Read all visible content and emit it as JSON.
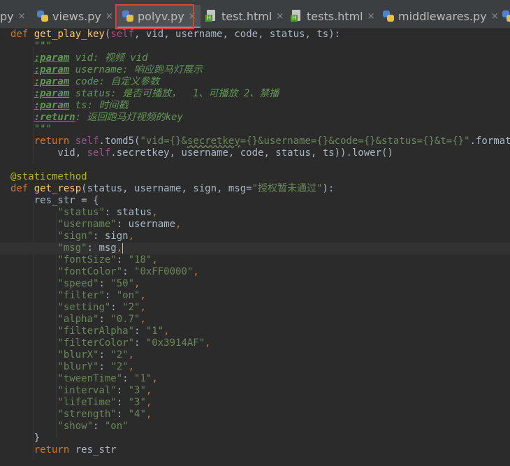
{
  "tabs": [
    {
      "label": "py",
      "type": "python",
      "close": "×"
    },
    {
      "label": "views.py",
      "type": "python",
      "close": "×"
    },
    {
      "label": "polyv.py",
      "type": "python",
      "close": "×",
      "active": true
    },
    {
      "label": "test.html",
      "type": "html",
      "close": "×"
    },
    {
      "label": "tests.html",
      "type": "html",
      "close": "×"
    },
    {
      "label": "middlewares.py",
      "type": "python",
      "close": "×"
    }
  ],
  "code": {
    "def1": "def",
    "fn1": "get_play_key",
    "params1_self": "self",
    "params1_rest": ", vid, username, code, status, ts):",
    "doc_open": "\"\"\"",
    "doc_lines": [
      {
        "tag": ":param",
        "name": " vid: ",
        "text": "视频 vid"
      },
      {
        "tag": ":param",
        "name": " username: ",
        "text": "响应跑马灯展示"
      },
      {
        "tag": ":param",
        "name": " code: ",
        "text": "自定义参数"
      },
      {
        "tag": ":param",
        "name": " status: ",
        "text": "是否可播放，  1、可播放 2、禁播"
      },
      {
        "tag": ":param",
        "name": " ts: ",
        "text": "时间戳"
      },
      {
        "tag": ":return",
        "name": ": ",
        "text": "返回跑马灯视频的key"
      }
    ],
    "doc_close": "\"\"\"",
    "return_kw": "return",
    "self2": "self",
    "tomd5": ".tomd5(",
    "fmt_str_a": "\"vid={}&",
    "fmt_str_b": "secretkey",
    "fmt_str_c": "={}&username={}&code={}&status={}&t={}\"",
    "format_call": ".format(",
    "line2_pre": "    vid, ",
    "line2_self": "self",
    "line2_post": ".secretkey, username, code, status, ts)).lower()",
    "decorator": "@staticmethod",
    "def2": "def",
    "fn2": "get_resp",
    "params2": "(status, username, sign, msg=",
    "params2_str": "\"授权暂未通过\"",
    "params2_end": "):",
    "res_open": "res_str = {",
    "dict_items": [
      {
        "key": "\"status\"",
        "val": "status",
        "is_str": false
      },
      {
        "key": "\"username\"",
        "val": "username",
        "is_str": false
      },
      {
        "key": "\"sign\"",
        "val": "sign",
        "is_str": false
      },
      {
        "key": "\"msg\"",
        "val": "msg",
        "is_str": false
      },
      {
        "key": "\"fontSize\"",
        "val": "\"18\"",
        "is_str": true
      },
      {
        "key": "\"fontColor\"",
        "val": "\"0xFF0000\"",
        "is_str": true
      },
      {
        "key": "\"speed\"",
        "val": "\"50\"",
        "is_str": true
      },
      {
        "key": "\"filter\"",
        "val": "\"on\"",
        "is_str": true
      },
      {
        "key": "\"setting\"",
        "val": "\"2\"",
        "is_str": true
      },
      {
        "key": "\"alpha\"",
        "val": "\"0.7\"",
        "is_str": true
      },
      {
        "key": "\"filterAlpha\"",
        "val": "\"1\"",
        "is_str": true
      },
      {
        "key": "\"filterColor\"",
        "val": "\"0x3914AF\"",
        "is_str": true
      },
      {
        "key": "\"blurX\"",
        "val": "\"2\"",
        "is_str": true
      },
      {
        "key": "\"blurY\"",
        "val": "\"2\"",
        "is_str": true
      },
      {
        "key": "\"tweenTime\"",
        "val": "\"1\"",
        "is_str": true
      },
      {
        "key": "\"interval\"",
        "val": "\"3\"",
        "is_str": true
      },
      {
        "key": "\"lifeTime\"",
        "val": "\"3\"",
        "is_str": true
      },
      {
        "key": "\"strength\"",
        "val": "\"4\"",
        "is_str": true
      },
      {
        "key": "\"show\"",
        "val": "\"on\"",
        "is_str": true,
        "last": true
      }
    ],
    "res_close": "}",
    "return2": "return",
    "return2_val": " res_str"
  }
}
